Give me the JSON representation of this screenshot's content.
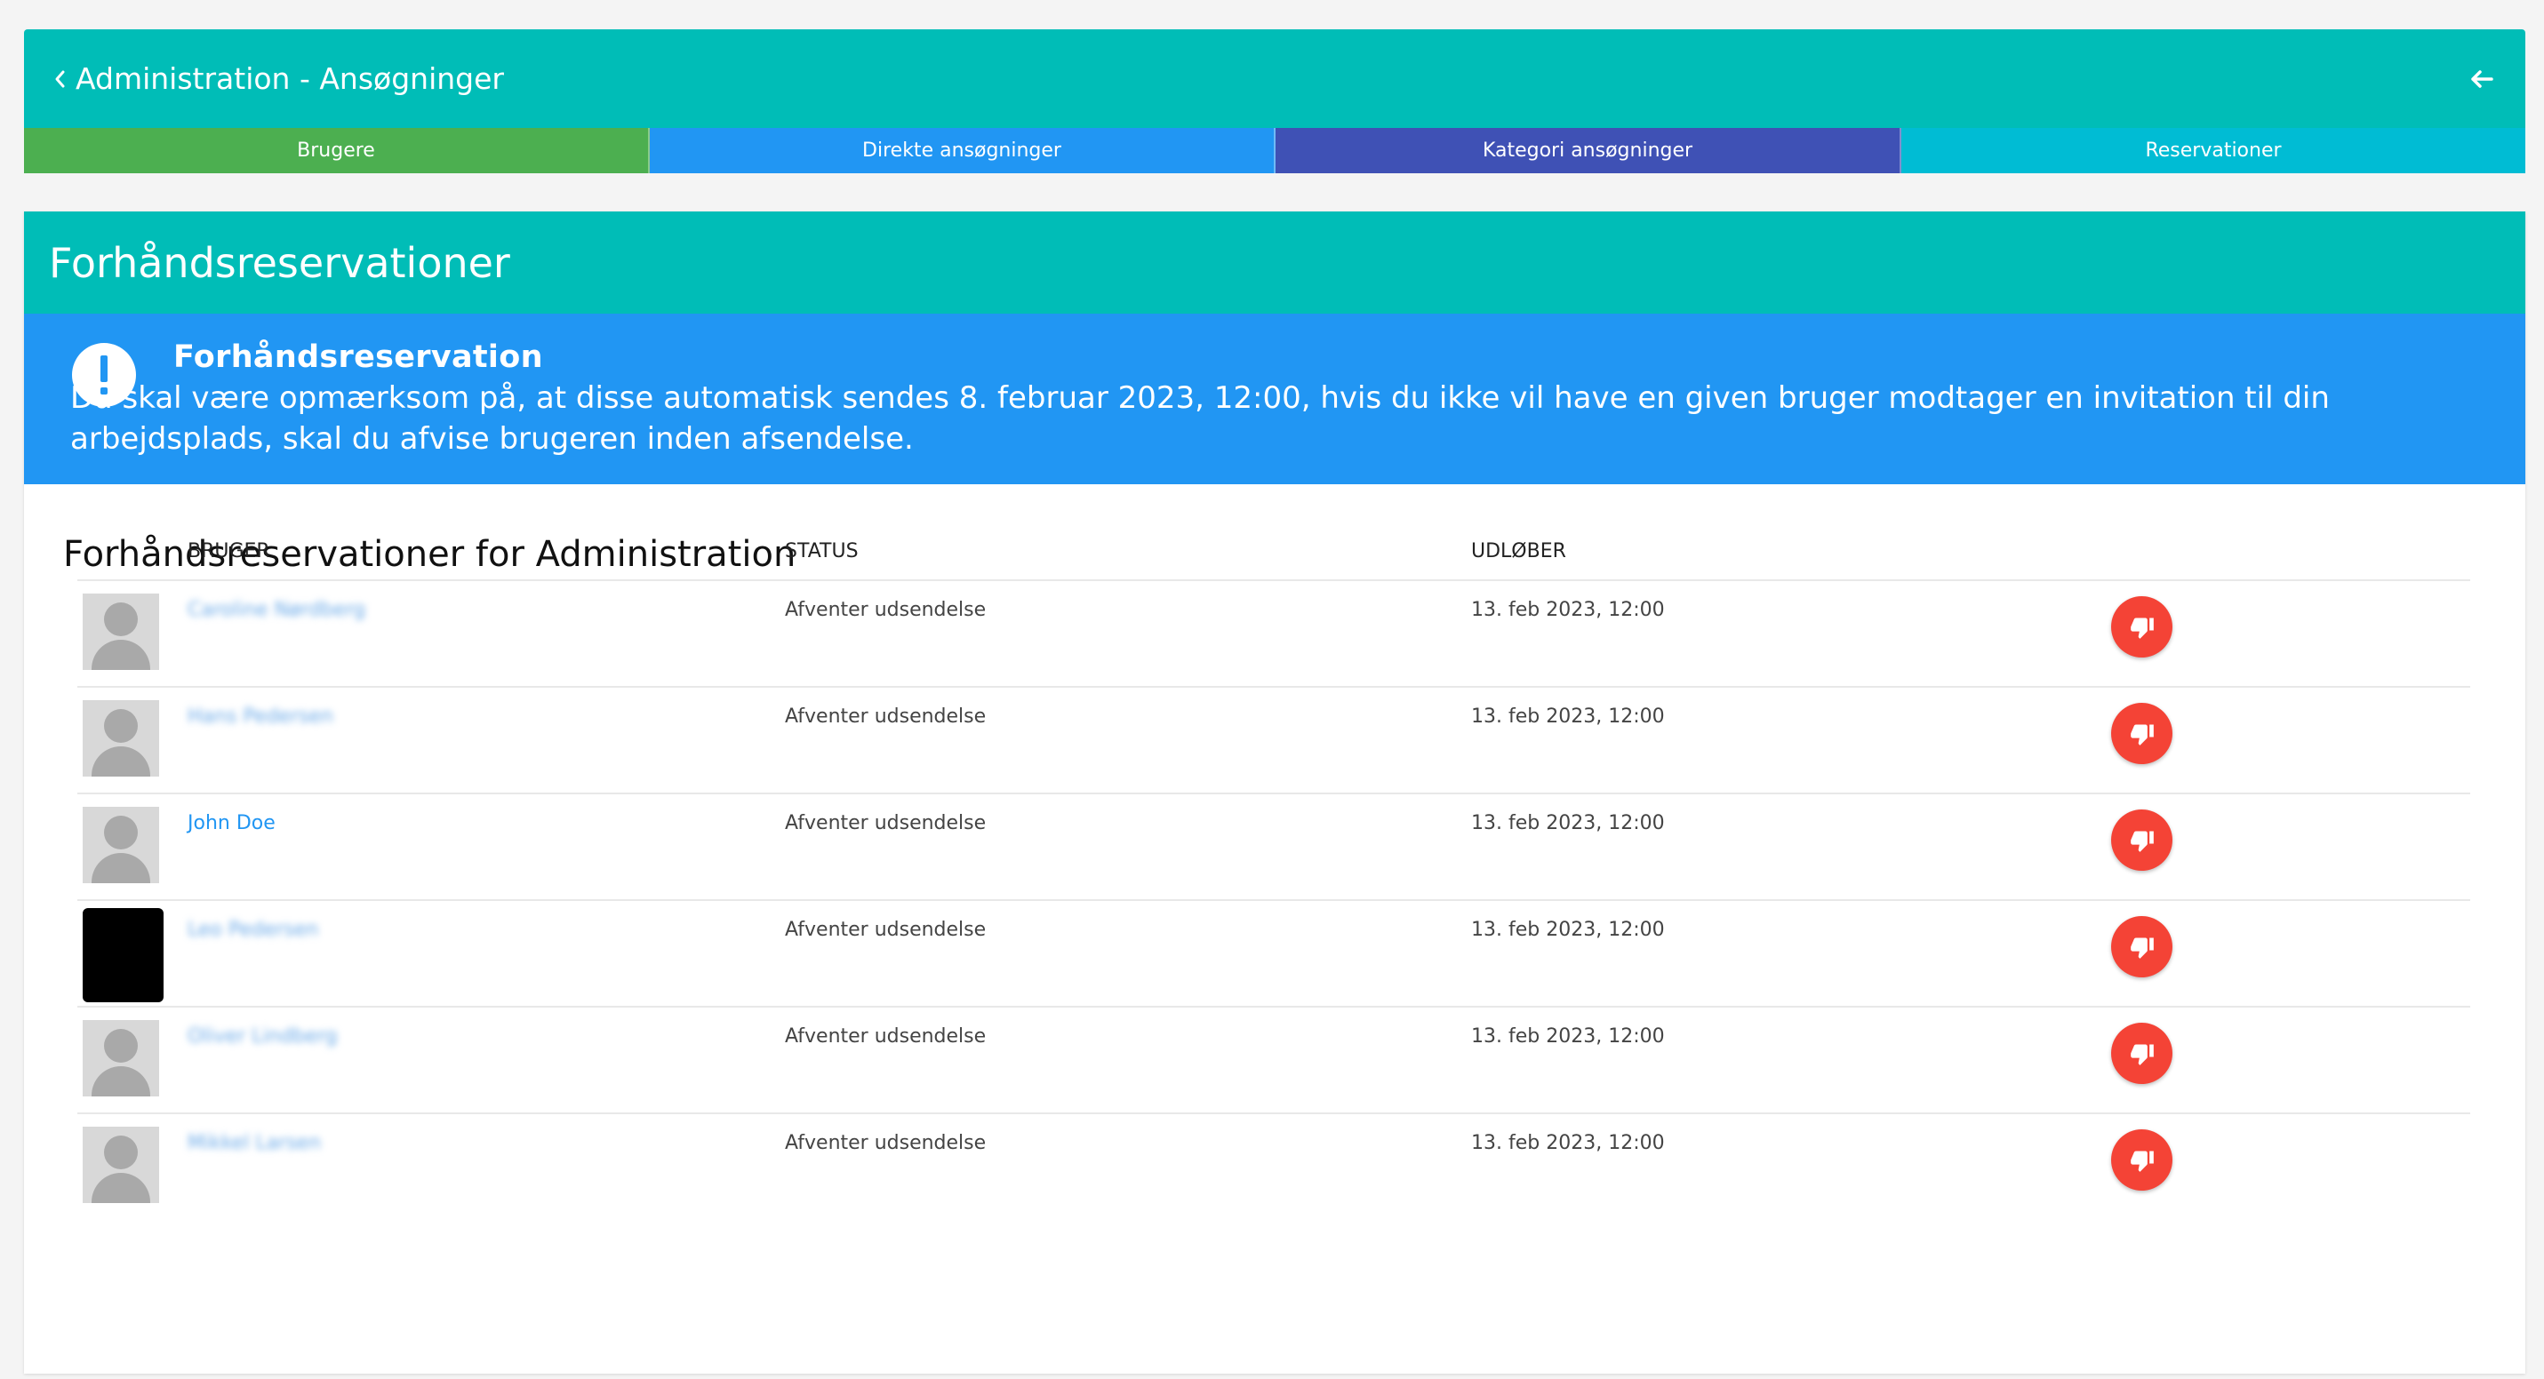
{
  "header": {
    "title": "Administration - Ansøgninger"
  },
  "tabs": [
    {
      "label": "Brugere",
      "color": "#4caf50"
    },
    {
      "label": "Direkte ansøgninger",
      "color": "#2196f3"
    },
    {
      "label": "Kategori ansøgninger",
      "color": "#3f51b5"
    },
    {
      "label": "Reservationer",
      "color": "#00bcd4"
    }
  ],
  "card": {
    "title": "Forhåndsreservationer",
    "alert": {
      "title": "Forhåndsreservation",
      "text": "Du skal være opmærksom på, at disse automatisk sendes 8. februar 2023, 12:00, hvis du ikke vil have en given bruger modtager en invitation til din arbejdsplads, skal du afvise brugeren inden afsendelse."
    },
    "section_title": "Forhåndsreservationer for Administration"
  },
  "table": {
    "columns": {
      "user": "BRUGER",
      "status": "STATUS",
      "expires": "UDLØBER"
    },
    "rows": [
      {
        "name": "Caroline Nørdberg",
        "status": "Afventer udsendelse",
        "expires": "13. feb 2023, 12:00"
      },
      {
        "name": "Hans Pedersen",
        "status": "Afventer udsendelse",
        "expires": "13. feb 2023, 12:00"
      },
      {
        "name": "John Doe",
        "status": "Afventer udsendelse",
        "expires": "13. feb 2023, 12:00"
      },
      {
        "name": "Leo Pedersen",
        "status": "Afventer udsendelse",
        "expires": "13. feb 2023, 12:00"
      },
      {
        "name": "Oliver Lindberg",
        "status": "Afventer udsendelse",
        "expires": "13. feb 2023, 12:00"
      },
      {
        "name": "Mikkel Larsen",
        "status": "Afventer udsendelse",
        "expires": "13. feb 2023, 12:00"
      }
    ]
  },
  "colors": {
    "primary": "#00bdb7",
    "alert": "#2196f3",
    "reject": "#f44336"
  },
  "icons": {
    "back": "arrow-left-icon",
    "chevron": "chevron-left-icon",
    "alert": "exclamation-icon",
    "reject": "thumbs-down-icon"
  }
}
